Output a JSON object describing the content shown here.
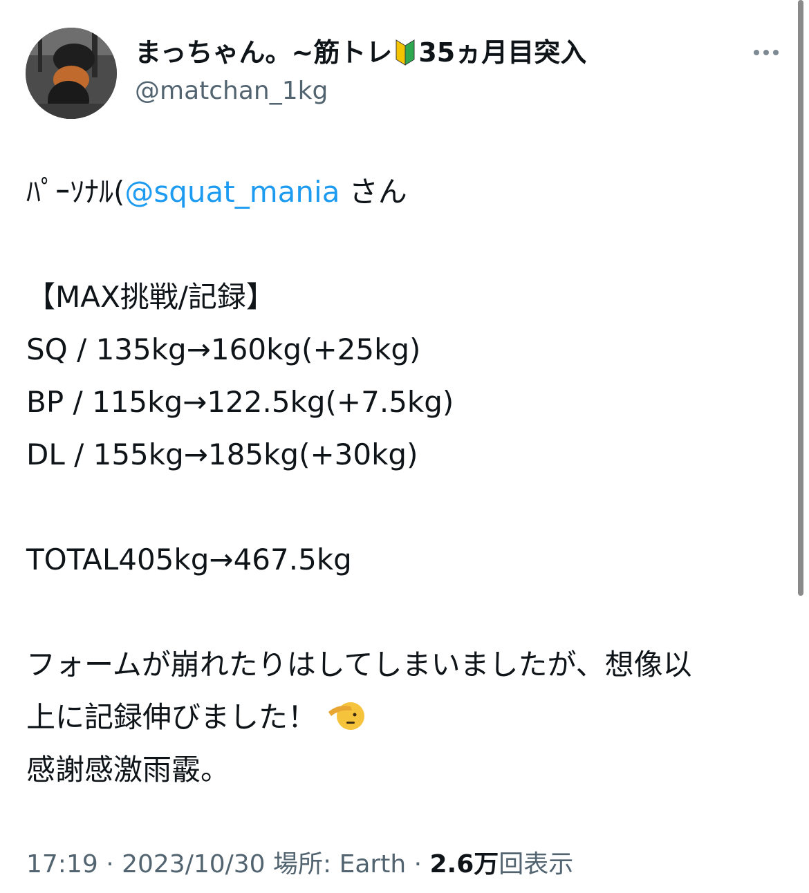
{
  "author": {
    "display_name_part1": "まっちゃん。~筋トレ",
    "badge_icon": "beginner-mark-icon",
    "display_name_part2": "35ヵ月目突入",
    "handle": "@matchan_1kg"
  },
  "tweet": {
    "line1_prefix": "ﾊﾟｰｿﾅﾙ(",
    "line1_mention": "@squat_mania",
    "line1_suffix": " さん",
    "heading": "【MAX挑戦/記録】",
    "records": [
      "SQ / 135kg→160kg(+25kg)",
      "BP / 115kg→122.5kg(+7.5kg)",
      "DL / 155kg→185kg(+30kg)"
    ],
    "total": "TOTAL405kg→467.5kg",
    "closing_line1": "フォームが崩れたりはしてしまいましたが、想像以",
    "closing_line2": "上に記録伸びました！",
    "closing_emoji": "saluting-face-icon",
    "closing_line3": "感謝感激雨霰。"
  },
  "meta": {
    "time": "17:19",
    "separator1": " · ",
    "date": "2023/10/30",
    "location": " 場所: Earth",
    "separator2": " · ",
    "view_count": "2.6万",
    "view_label": "回表示"
  },
  "colors": {
    "link": "#1d9bf0",
    "text": "#0f1419",
    "secondary": "#536471"
  }
}
